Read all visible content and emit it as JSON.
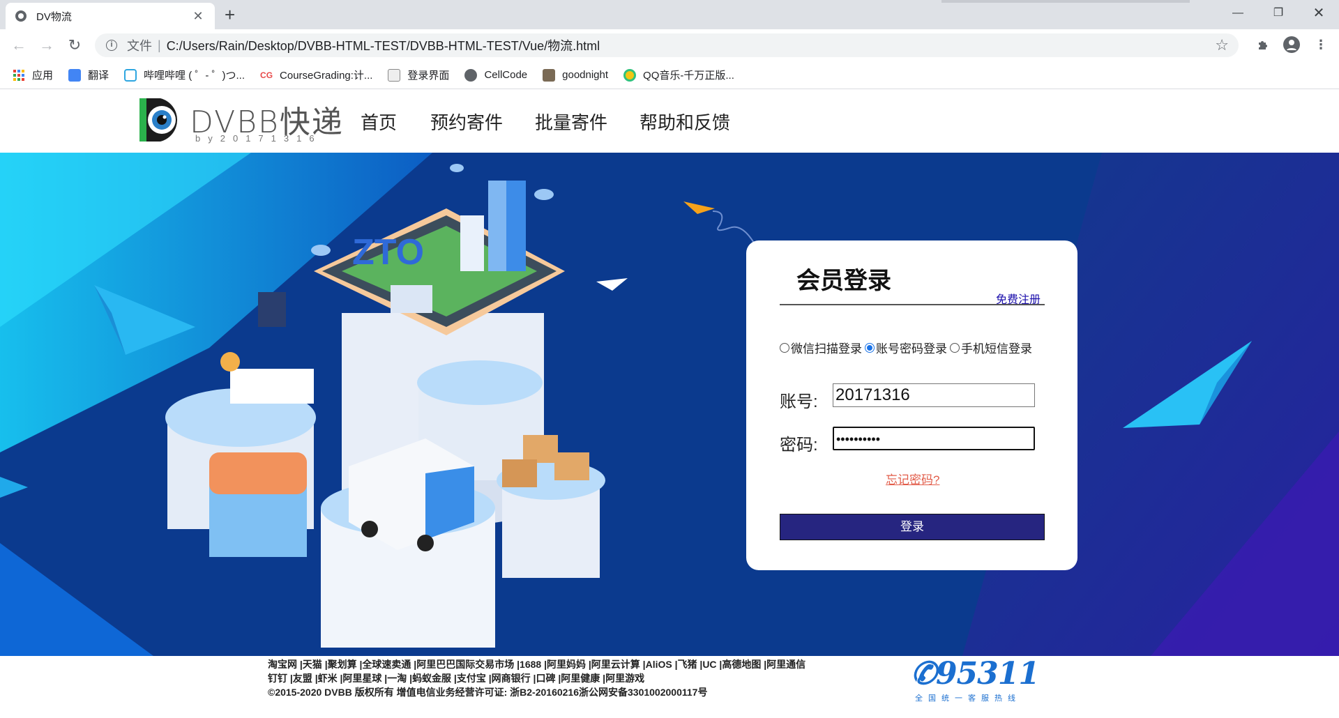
{
  "browser": {
    "tab_title": "DV物流",
    "tab_close": "✕",
    "new_tab": "+",
    "window_controls": {
      "minimize": "—",
      "restore": "❐",
      "close": "✕"
    },
    "nav": {
      "back": "←",
      "forward": "→",
      "reload": "↻"
    },
    "address": {
      "scheme_label": "文件",
      "separator": "|",
      "url": "C:/Users/Rain/Desktop/DVBB-HTML-TEST/DVBB-HTML-TEST/Vue/物流.html"
    },
    "bookmarks": [
      {
        "label": "应用",
        "icon": "apps-grid-icon",
        "color": "#ea4335"
      },
      {
        "label": "翻译",
        "icon": "translate-icon",
        "color": "#4285f4"
      },
      {
        "label": "哔哩哔哩 ( ゜- ゜)つ...",
        "icon": "bilibili-icon",
        "color": "#2ea6e0"
      },
      {
        "label": "CourseGrading:计...",
        "icon": "cg-icon",
        "color": "#e84a4a"
      },
      {
        "label": "登录界面",
        "icon": "page-icon",
        "color": "#888888"
      },
      {
        "label": "CellCode",
        "icon": "globe-icon",
        "color": "#5f6368"
      },
      {
        "label": "goodnight",
        "icon": "image-icon",
        "color": "#7a6a55"
      },
      {
        "label": "QQ音乐-千万正版...",
        "icon": "qqmusic-icon",
        "color": "#f3c614"
      }
    ]
  },
  "site": {
    "logo_text": "DVBB快递",
    "logo_sub": "by20171316",
    "nav": [
      {
        "label": "首页"
      },
      {
        "label": "预约寄件"
      },
      {
        "label": "批量寄件"
      },
      {
        "label": "帮助和反馈"
      }
    ]
  },
  "login": {
    "title": "会员登录",
    "register": "免费注册",
    "methods": [
      {
        "label": "微信扫描登录",
        "checked": false
      },
      {
        "label": "账号密码登录",
        "checked": true
      },
      {
        "label": "手机短信登录",
        "checked": false
      }
    ],
    "account_label": "账号:",
    "account_value": "20171316",
    "password_label": "密码:",
    "password_mask": "••••••••••",
    "forgot": "忘记密码?",
    "submit": "登录"
  },
  "banner": {
    "zto_text": "ZTO"
  },
  "footer": {
    "line1": "淘宝网 |天猫 |聚划算 |全球速卖通 |阿里巴巴国际交易市场 |1688 |阿里妈妈 |阿里云计算 |AliOS |飞猪 |UC |高德地图 |阿里通信",
    "line2": "钉钉 |友盟 |虾米 |阿里星球 |一淘 |蚂蚁金服 |支付宝 |网商银行 |口碑 |阿里健康 |阿里游戏",
    "line3": "©2015-2020 DVBB 版权所有 增值电信业务经营许可证:  浙B2-20160216浙公网安备3301002000117号",
    "hotline": "95311",
    "hotline_sub": "全国统一客服热线"
  }
}
